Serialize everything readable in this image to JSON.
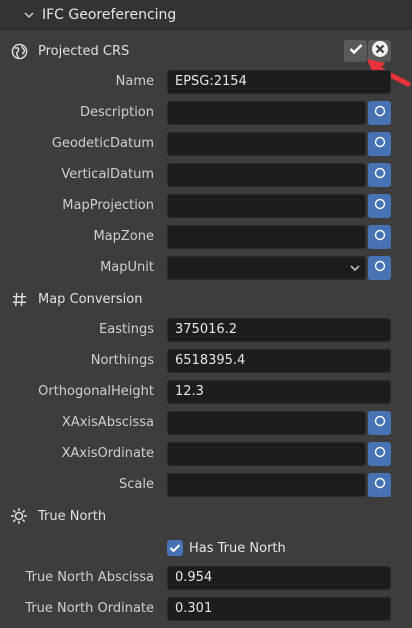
{
  "panel": {
    "title": "IFC Georeferencing"
  },
  "projected_crs": {
    "title": "Projected CRS",
    "fields": [
      {
        "label": "Name",
        "value": "EPSG:2154"
      },
      {
        "label": "Description",
        "value": ""
      },
      {
        "label": "GeodeticDatum",
        "value": ""
      },
      {
        "label": "VerticalDatum",
        "value": ""
      },
      {
        "label": "MapProjection",
        "value": ""
      },
      {
        "label": "MapZone",
        "value": ""
      },
      {
        "label": "MapUnit",
        "value": ""
      }
    ]
  },
  "map_conversion": {
    "title": "Map Conversion",
    "fields": [
      {
        "label": "Eastings",
        "value": "375016.2"
      },
      {
        "label": "Northings",
        "value": "6518395.4"
      },
      {
        "label": "OrthogonalHeight",
        "value": "12.3"
      },
      {
        "label": "XAxisAbscissa",
        "value": ""
      },
      {
        "label": "XAxisOrdinate",
        "value": ""
      },
      {
        "label": "Scale",
        "value": ""
      }
    ]
  },
  "true_north": {
    "title": "True North",
    "has_true_north_label": "Has True North",
    "has_true_north_checked": true,
    "fields": [
      {
        "label": "True North Abscissa",
        "value": "0.954"
      },
      {
        "label": "True North Ordinate",
        "value": "0.301"
      }
    ]
  },
  "colors": {
    "accent": "#4772b3",
    "annotation_arrow": "#e8333b",
    "background": "#3d3d3d",
    "field": "#1d1d1d"
  }
}
